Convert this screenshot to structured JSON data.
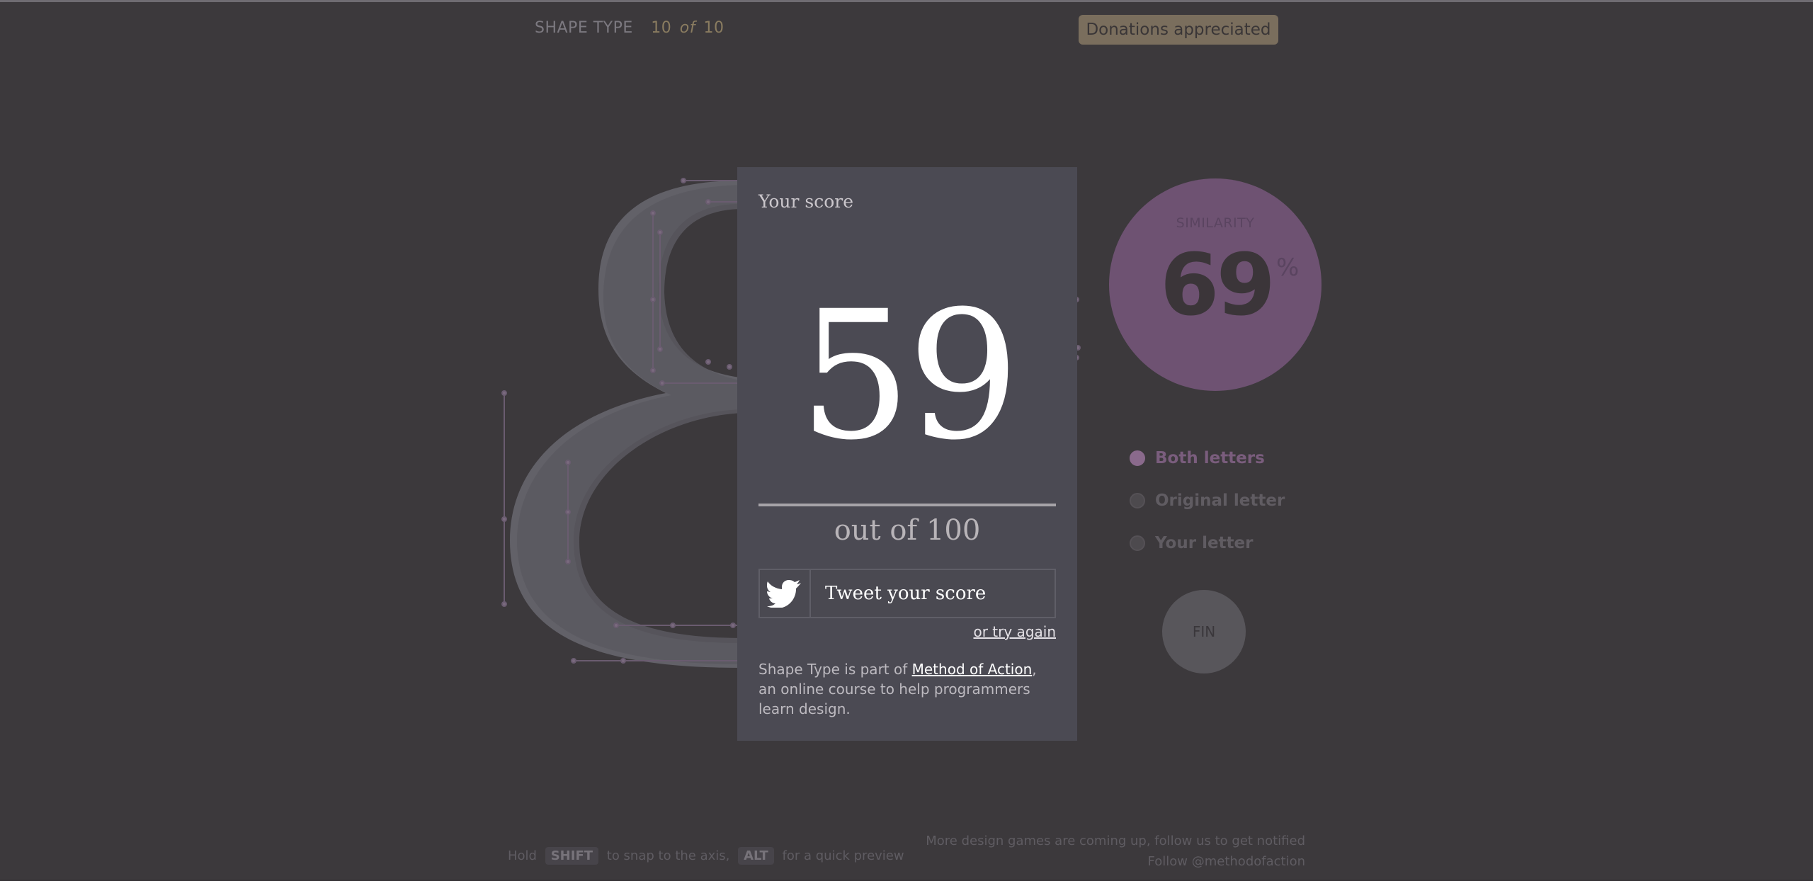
{
  "header": {
    "title": "SHAPE TYPE",
    "progress_current": "10",
    "progress_of": "of",
    "progress_total": "10"
  },
  "donate_label": "Donations appreciated",
  "score": {
    "label": "Your score",
    "value": "59",
    "out_of": "out of 100",
    "tweet_label": "Tweet your score",
    "try_again": "or try again"
  },
  "about": {
    "prefix": "Shape Type is part of ",
    "link": "Method of Action",
    "suffix": ", an online course to help programmers learn design."
  },
  "similarity": {
    "label": "SIMILARITY",
    "value": "69",
    "unit": "%"
  },
  "view_options": [
    {
      "label": "Both letters",
      "selected": true
    },
    {
      "label": "Original letter",
      "selected": false
    },
    {
      "label": "Your letter",
      "selected": false
    }
  ],
  "fin_label": "FIN",
  "footer": {
    "hold": "Hold",
    "shift_key": "SHIFT",
    "snap_text": "to snap to the axis,",
    "alt_key": "ALT",
    "preview_text": "for a quick preview",
    "news": "More design games are coming up, follow us to get notified",
    "follow": "Follow @methodofaction"
  },
  "colors": {
    "background": "#3c393c",
    "panel": "#4b4a53",
    "similarity_circle": "#6e5272",
    "donate_button": "#7a6e5d",
    "glyph_fill": "#5c5b62"
  },
  "icons": [
    "twitter-bird-icon"
  ]
}
